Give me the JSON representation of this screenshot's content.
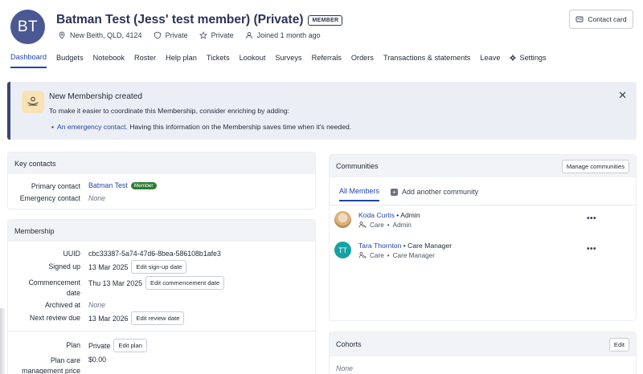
{
  "profile": {
    "initials": "BT",
    "name": "Batman Test (Jess' test member) (Private)",
    "badge": "MEMBER",
    "location": "New Beith, QLD, 4124",
    "privacy1": "Private",
    "privacy2": "Private",
    "joined": "Joined 1 month ago",
    "contact_card": "Contact card",
    "avatar_color": "#4a5893"
  },
  "tabs": [
    {
      "label": "Dashboard",
      "active": true
    },
    {
      "label": "Budgets"
    },
    {
      "label": "Notebook"
    },
    {
      "label": "Roster"
    },
    {
      "label": "Help plan"
    },
    {
      "label": "Tickets"
    },
    {
      "label": "Lookout"
    },
    {
      "label": "Surveys"
    },
    {
      "label": "Referrals"
    },
    {
      "label": "Orders"
    },
    {
      "label": "Transactions & statements"
    },
    {
      "label": "Leave"
    },
    {
      "label": "Settings",
      "icon": "gear-icon"
    }
  ],
  "banner": {
    "title": "New Membership created",
    "text": "To make it easier to coordinate this Membership, consider enriching by adding:",
    "bullet_link": "An emergency contact.",
    "bullet_rest": "Having this information on the Membership saves time when it's needed."
  },
  "key_contacts": {
    "title": "Key contacts",
    "primary_label": "Primary contact",
    "primary_value": "Batman Test",
    "primary_pill": "Member",
    "emergency_label": "Emergency contact",
    "emergency_value": "None"
  },
  "membership": {
    "title": "Membership",
    "uuid_label": "UUID",
    "uuid_value": "cbc33387-5a74-47d6-8bea-586108b1afe3",
    "signed_label": "Signed up",
    "signed_value": "13 Mar 2025",
    "signed_btn": "Edit sign-up date",
    "commence_label_1": "Commencement",
    "commence_label_2": "date",
    "commence_value": "Thu 13 Mar 2025",
    "commence_btn": "Edit commencement date",
    "archived_label": "Archived at",
    "archived_value": "None",
    "review_label": "Next review due",
    "review_value": "13 Mar 2026",
    "review_btn": "Edit review date",
    "plan_label": "Plan",
    "plan_value": "Private",
    "plan_btn": "Edit plan",
    "price_label_1": "Plan care",
    "price_label_2": "management price",
    "price_value": "$0.00"
  },
  "communities": {
    "title": "Communities",
    "manage_btn": "Manage communities",
    "tab_all": "All Members",
    "tab_add": "Add another community",
    "members": [
      {
        "name": "Koda Curtis",
        "role": "Admin",
        "community": "Care",
        "sub_role": "Admin"
      },
      {
        "name": "Tara Thornton",
        "role": "Care Manager",
        "community": "Care",
        "sub_role": "Care Manager",
        "initials": "TT"
      }
    ]
  },
  "cohorts": {
    "title": "Cohorts",
    "edit_btn": "Edit",
    "value": "None"
  },
  "separator": "•",
  "colors": {
    "accent": "#2146a8",
    "banner_bg": "#eceef5",
    "member_pill": "#2e7d32",
    "teal_avatar": "#14a3a3"
  }
}
